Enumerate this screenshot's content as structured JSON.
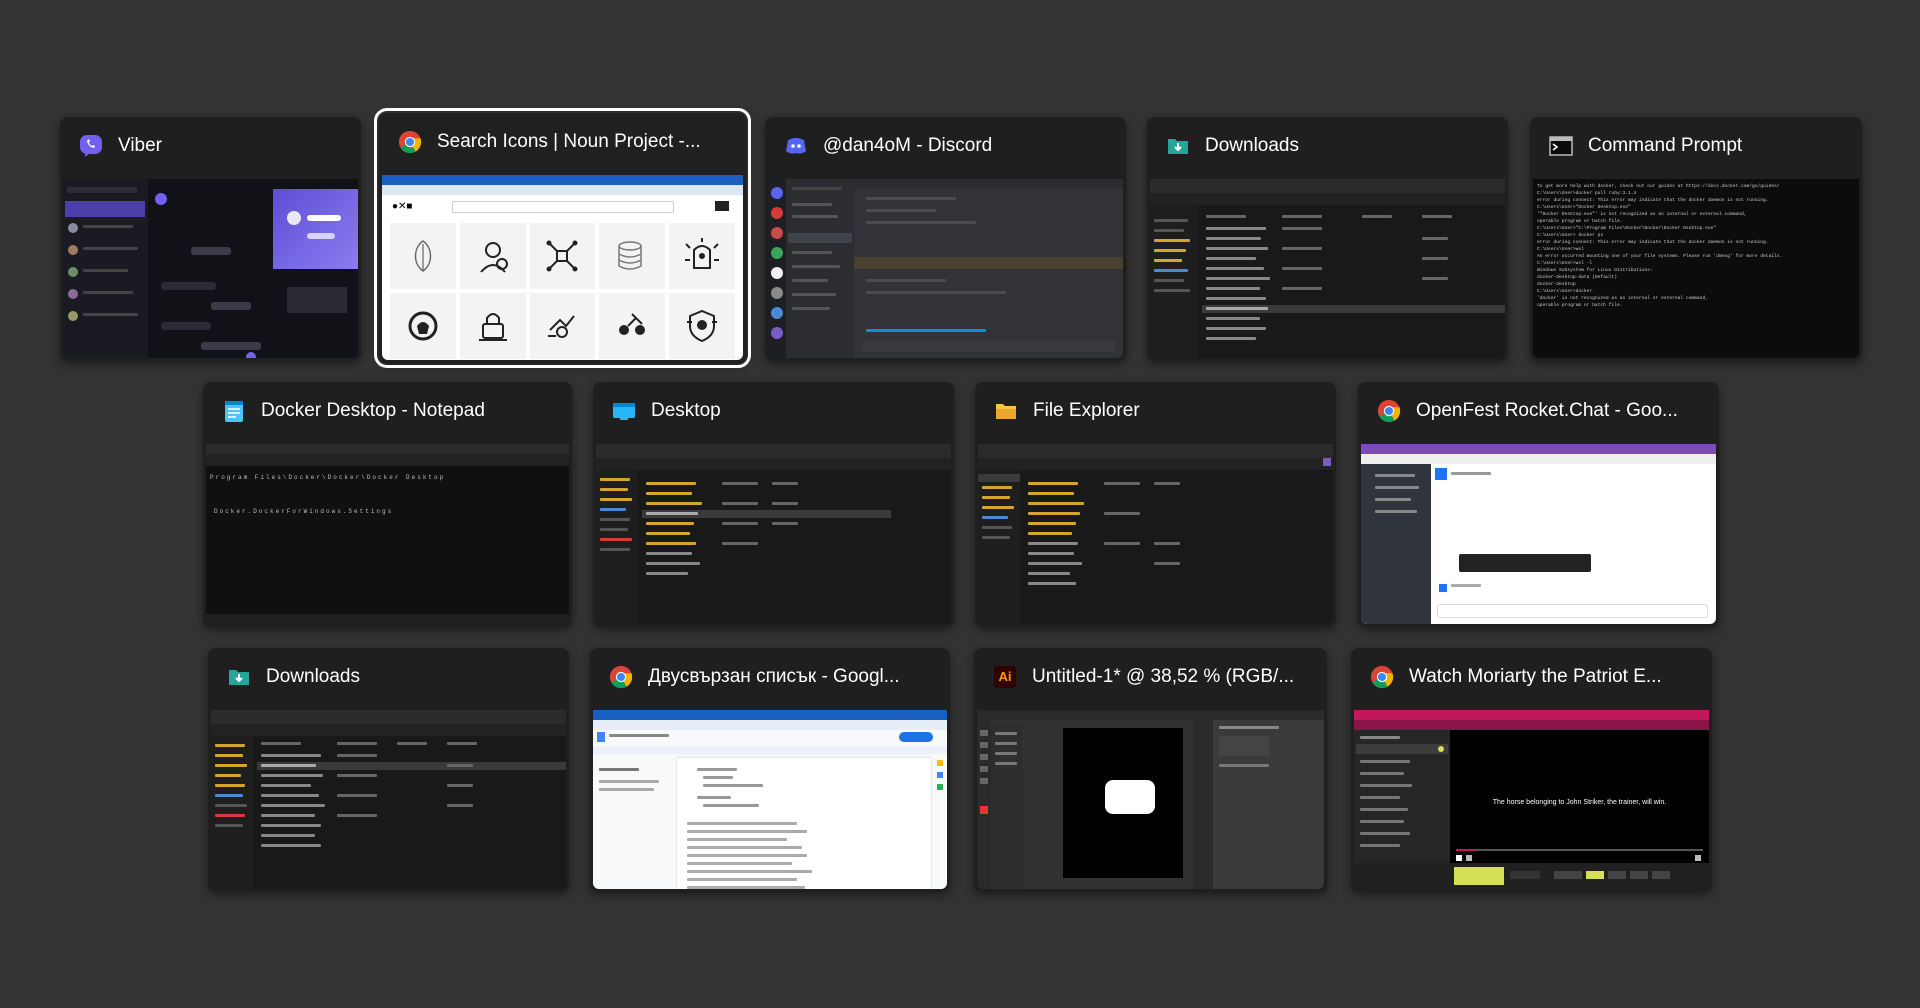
{
  "windows": [
    {
      "title": "Viber",
      "icon": "viber-icon",
      "color": "#7360f2"
    },
    {
      "title": "Search Icons | Noun Project -...",
      "icon": "chrome-icon",
      "selected": true
    },
    {
      "title": "@dan4oM - Discord",
      "icon": "discord-icon",
      "color": "#5865f2"
    },
    {
      "title": "Downloads",
      "icon": "downloads-folder-icon",
      "color": "#26a69a"
    },
    {
      "title": "Command Prompt",
      "icon": "command-prompt-icon"
    },
    {
      "title": "Docker Desktop - Notepad",
      "icon": "notepad-icon",
      "color": "#4fc3f7"
    },
    {
      "title": "Desktop",
      "icon": "desktop-folder-icon",
      "color": "#29b6f6"
    },
    {
      "title": "File Explorer",
      "icon": "file-explorer-icon",
      "color": "#f9c642"
    },
    {
      "title": "OpenFest Rocket.Chat - Goo...",
      "icon": "chrome-icon"
    },
    {
      "title": "Downloads",
      "icon": "downloads-folder-icon",
      "color": "#26a69a"
    },
    {
      "title": "Двусвързан списък - Googl...",
      "icon": "chrome-icon"
    },
    {
      "title": "Untitled-1* @ 38,52 % (RGB/...",
      "icon": "illustrator-icon",
      "color": "#ff9a00"
    },
    {
      "title": "Watch Moriarty the Patriot E...",
      "icon": "chrome-icon"
    }
  ],
  "thumbnails": {
    "illustrator_text": "Ai",
    "video_caption": "The horse belonging to John Striker, the trainer, will win.",
    "notepad_path_line": "Program Files\\Docker\\Docker\\Docker Desktop",
    "notepad_settings_line": "Docker.DockerForWindows.Settings",
    "cmd_lines": [
      "To get more help with docker, check out our guides at https://docs.docker.com/go/guides/",
      "C:\\Users\\User>docker pull ruby:3.1.4",
      "error during connect: This error may indicate that the docker daemon is not running.",
      "C:\\Users\\User>\"Docker Desktop.exe\"",
      "'\"Docker Desktop.exe\"' is not recognized as an internal or external command,",
      "operable program or batch file.",
      "C:\\Users\\User>\"C:\\Program Files\\Docker\\Docker\\Docker Desktop.exe\"",
      "C:\\Users\\User> docker ps",
      "error during connect: This error may indicate that the docker daemon is not running.",
      "C:\\Users\\User>wsl",
      "An error occurred mounting one of your file systems. Please run 'dmesg' for more details.",
      "C:\\Users\\User>wsl -l",
      "Windows Subsystem for Linux Distributions:",
      "docker-desktop-data (Default)",
      "docker-desktop",
      "C:\\Users\\User>docker",
      "'docker' is not recognized as an internal or external command,",
      "operable program or batch file."
    ]
  }
}
